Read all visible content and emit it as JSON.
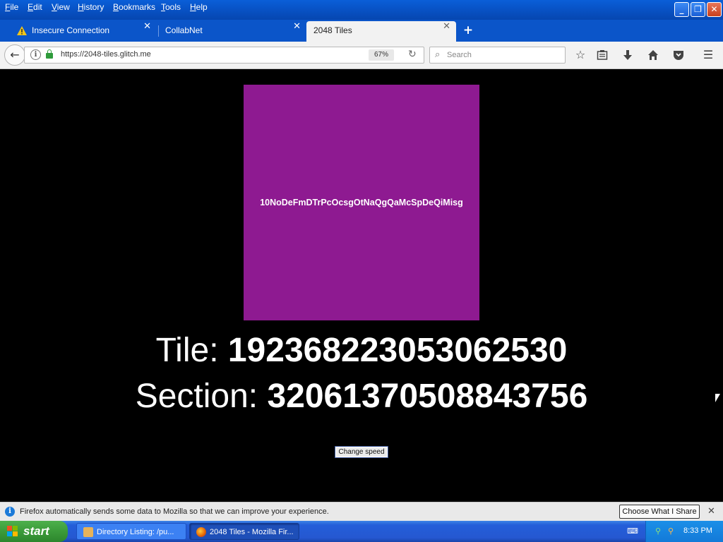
{
  "menubar": {
    "items": [
      "File",
      "Edit",
      "View",
      "History",
      "Bookmarks",
      "Tools",
      "Help"
    ]
  },
  "window_controls": {
    "minimize": "_",
    "restore": "❐",
    "close": "✕"
  },
  "tabs": [
    {
      "label": "Insecure Connection",
      "icon": "warning-icon",
      "active": false
    },
    {
      "label": "CollabNet",
      "icon": "",
      "active": false
    },
    {
      "label": "2048 Tiles",
      "icon": "",
      "active": true
    }
  ],
  "navbar": {
    "url": "https://2048-tiles.glitch.me",
    "zoom": "67%",
    "search_placeholder": "Search"
  },
  "page": {
    "tile_text": "10NoDeFmDTrPcOcsgOtNaQgQaMcSpDeQiMisg",
    "tile_color": "#8e1a91",
    "tile_label": "Tile: ",
    "tile_value": "1923682230530625‍30",
    "section_label": "Section: ",
    "section_value": "32061370508843756",
    "button_label": "Change speed"
  },
  "notification": {
    "message": "Firefox automatically sends some data to Mozilla so that we can improve your experience.",
    "button_label": "Choose What I Share"
  },
  "taskbar": {
    "start_label": "start",
    "buttons": [
      {
        "label": "Directory Listing: /pu...",
        "active": false
      },
      {
        "label": "2048 Tiles - Mozilla Fir...",
        "active": true
      }
    ],
    "clock": "8:33 PM"
  }
}
